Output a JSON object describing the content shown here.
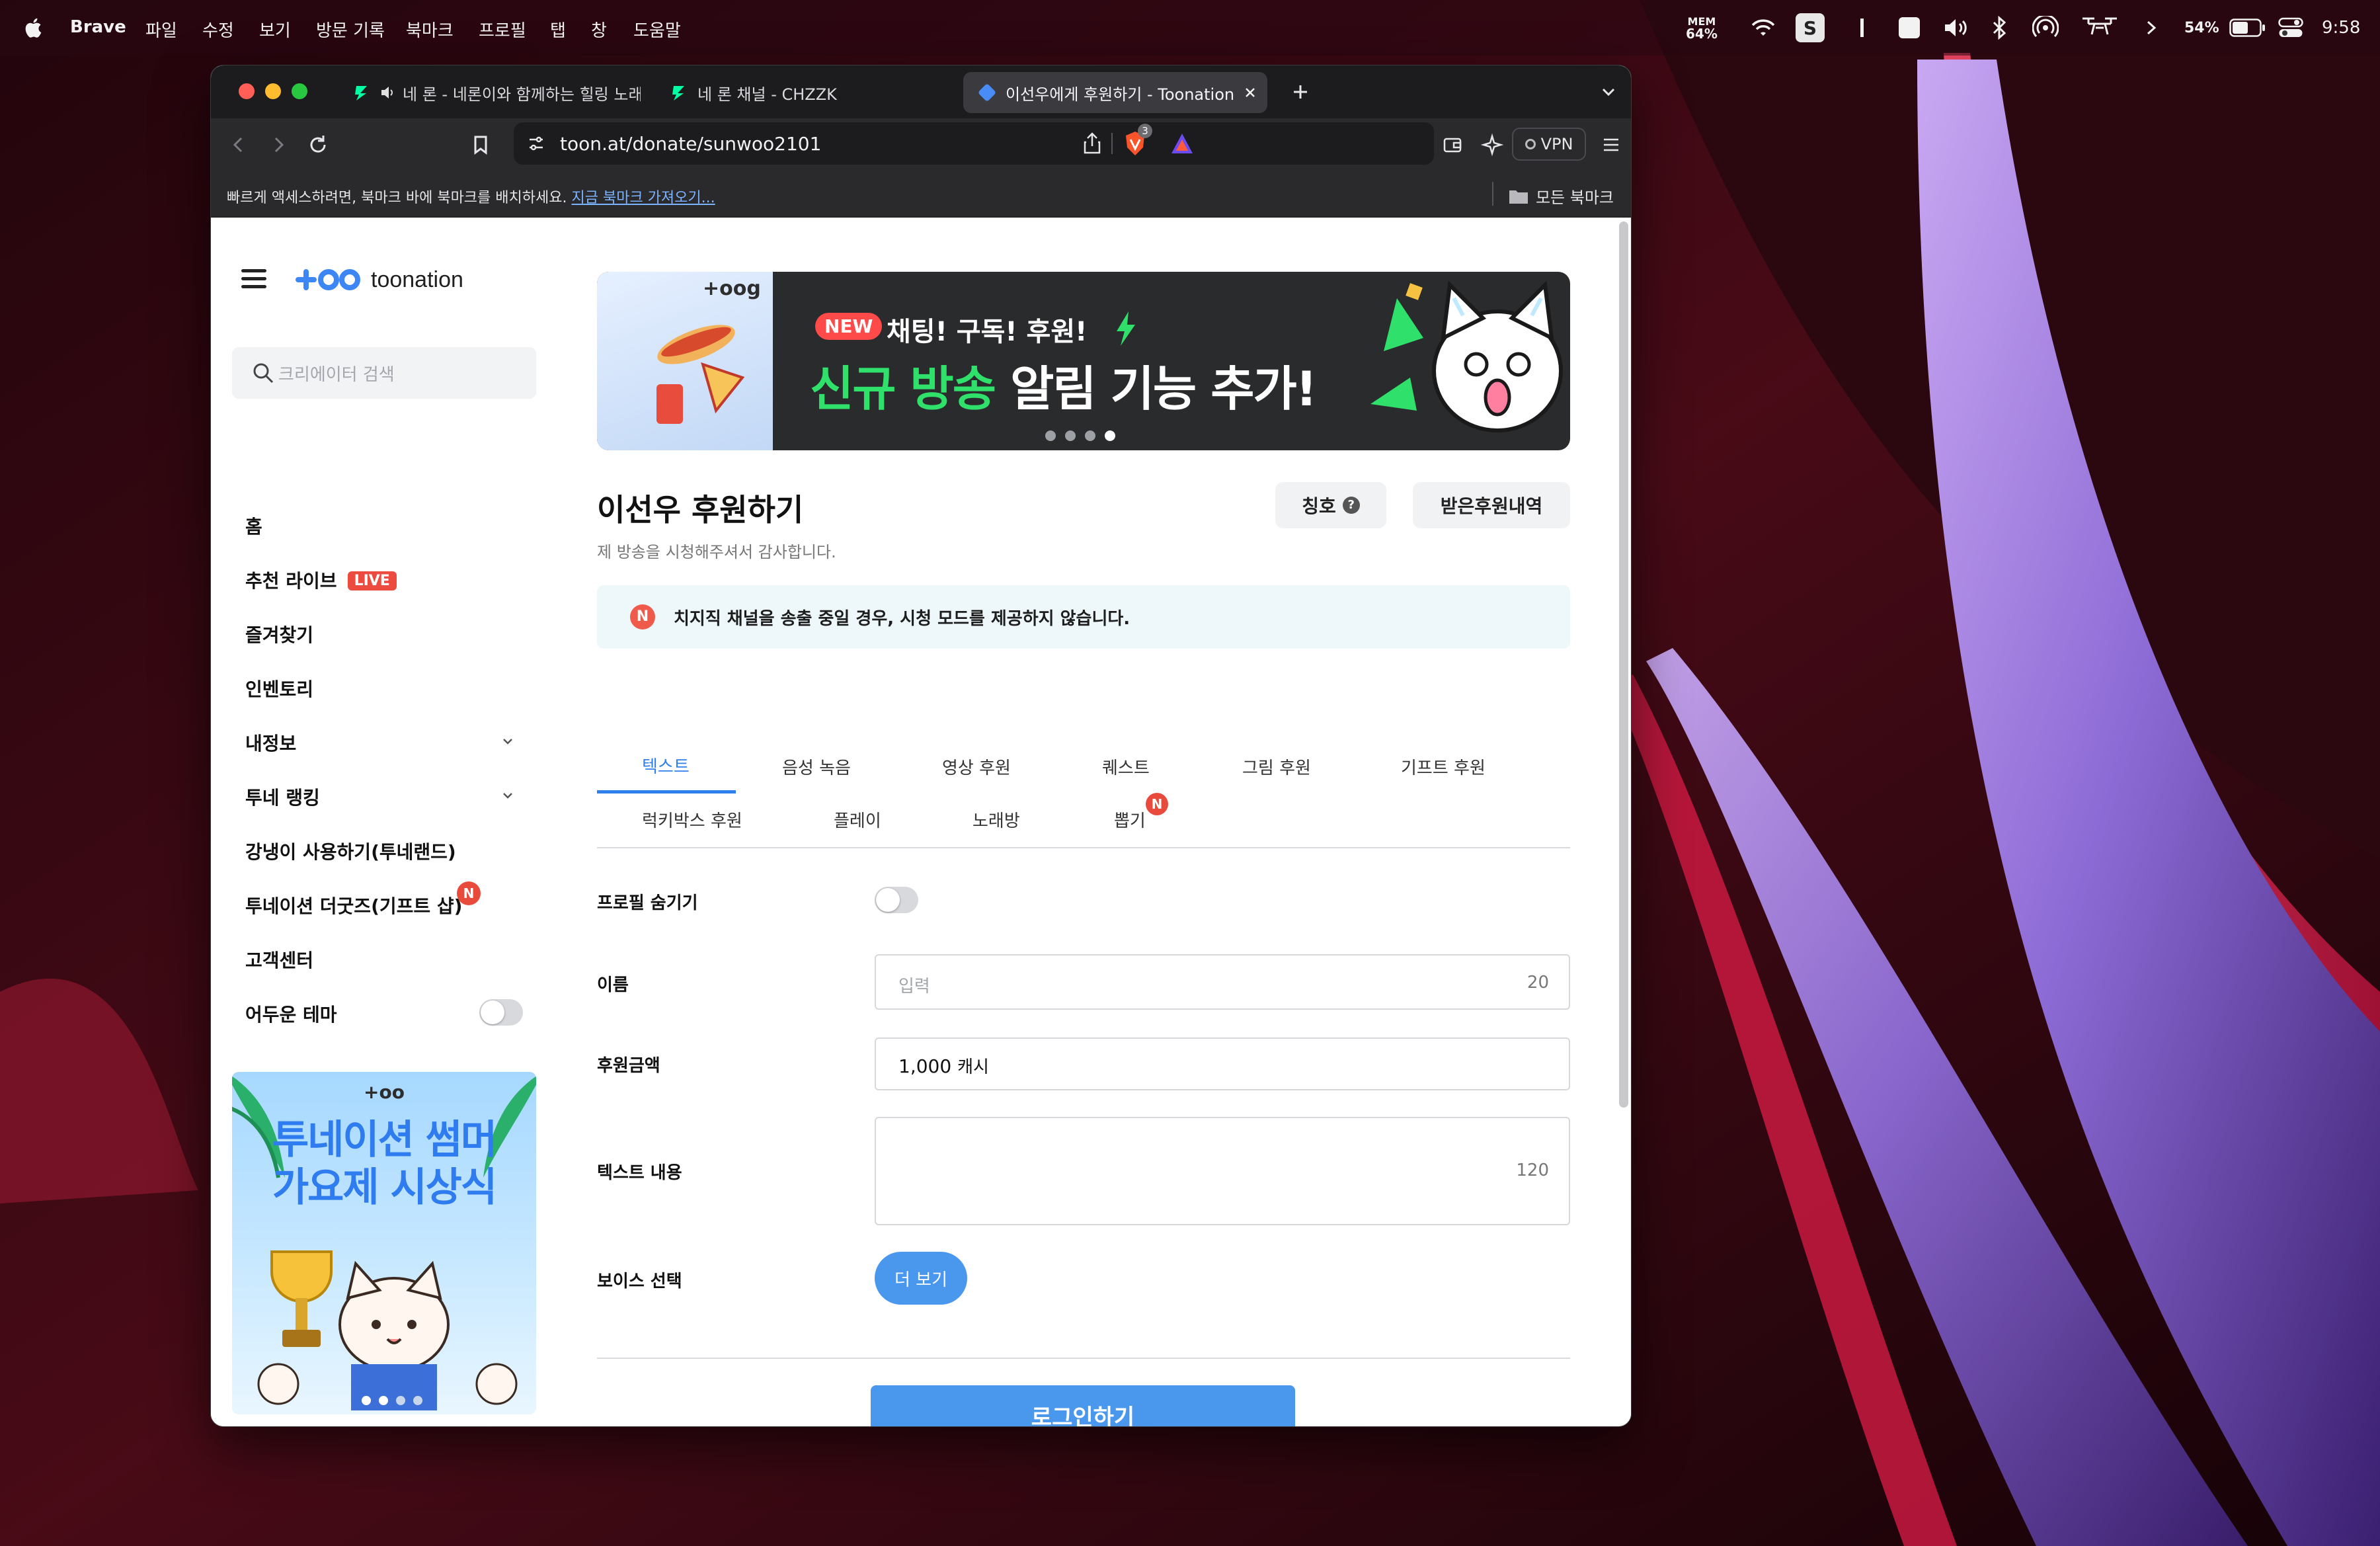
{
  "menubar": {
    "app_name": "Brave",
    "items": [
      "파일",
      "수정",
      "보기",
      "방문 기록",
      "북마크",
      "프로필",
      "탭",
      "창",
      "도움말"
    ],
    "mem_label": "MEM",
    "mem_value": "64%",
    "battery": "54%",
    "time": "9:58"
  },
  "browser": {
    "tabs": [
      {
        "title": "네 론 - 네론이와 함께하는 힐링 노래",
        "active": false
      },
      {
        "title": "네 론 채널 - CHZZK",
        "active": false
      },
      {
        "title": "이선우에게 후원하기 - Toonation",
        "active": true
      }
    ],
    "url": "toon.at/donate/sunwoo2101",
    "shield_count": "3",
    "vpn_label": "VPN",
    "bookmark_message": "빠르게 액세스하려면, 북마크 바에 북마크를 배치하세요.",
    "bookmark_link": "지금 북마크 가져오기...",
    "all_bookmarks": "모든 북마크"
  },
  "sidebar": {
    "logo_text": "toonation",
    "search_placeholder": "크리에이터 검색",
    "items": [
      {
        "label": "홈"
      },
      {
        "label": "추천 라이브",
        "badge": "LIVE"
      },
      {
        "label": "즐겨찾기"
      },
      {
        "label": "인벤토리"
      },
      {
        "label": "내정보",
        "expandable": true
      },
      {
        "label": "투네 랭킹",
        "expandable": true
      },
      {
        "label": "강냉이 사용하기(투네랜드)"
      },
      {
        "label": "투네이션 더굿즈(기프트 샵)",
        "badge": "N"
      },
      {
        "label": "고객센터"
      },
      {
        "label": "어두운 테마",
        "toggle": false
      }
    ],
    "promo": {
      "logo": "+oo",
      "line1": "투네이션 썸머",
      "line2": "가요제 시상식"
    }
  },
  "banner": {
    "logo": "+oog",
    "new_badge": "NEW",
    "line1": "채팅! 구독! 후원!",
    "line2_green": "신규 방송",
    "line2_white": "알림 기능 추가!",
    "slides": 4,
    "active_slide": 4
  },
  "main": {
    "title": "이선우 후원하기",
    "subtitle": "제 방송을 시청해주셔서 감사합니다.",
    "title_button": "칭호",
    "history_button": "받은후원내역",
    "notice_icon": "N",
    "notice": "치지직 채널을 송출 중일 경우, 시청 모드를 제공하지 않습니다.",
    "tabs_row1": [
      "텍스트",
      "음성 녹음",
      "영상 후원",
      "퀘스트",
      "그림 후원",
      "기프트 후원"
    ],
    "tabs_row2": [
      "럭키박스 후원",
      "플레이",
      "노래방",
      "뽑기"
    ],
    "new_tab_badge": "N",
    "form": {
      "hide_profile_label": "프로필 숨기기",
      "hide_profile": false,
      "name_label": "이름",
      "name_placeholder": "입력",
      "name_max": "20",
      "amount_label": "후원금액",
      "amount_value": "1,000",
      "amount_unit": "캐시",
      "text_label": "텍스트 내용",
      "text_max": "120",
      "voice_label": "보이스 선택",
      "voice_button": "더 보기",
      "login_button": "로그인하기"
    }
  },
  "colors": {
    "accent": "#4a97ee",
    "tab_active": "#2f80ed",
    "live": "#eb4c3f",
    "new_badge": "#e84b3b",
    "banner_green": "#2fe06a"
  }
}
